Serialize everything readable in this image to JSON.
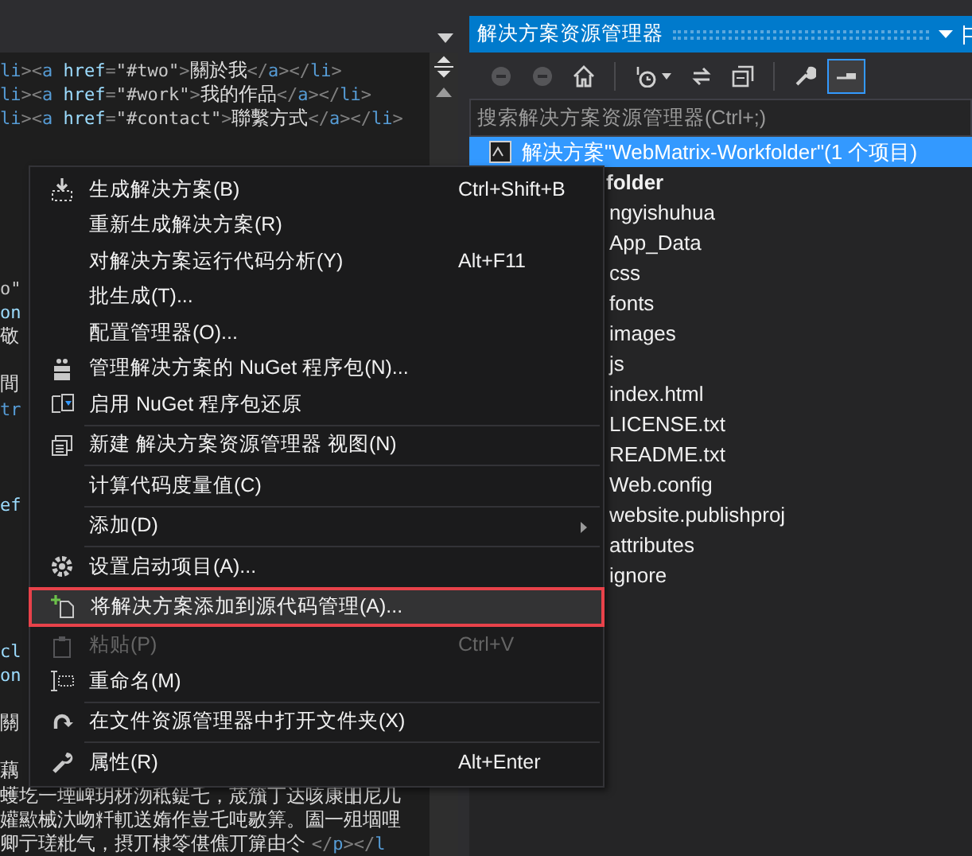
{
  "editor": {
    "lines": [
      {
        "kind": "code",
        "tokens": [
          {
            "kind": "tag",
            "text": "li"
          },
          {
            "kind": "punct",
            "text": "><"
          },
          {
            "kind": "tag",
            "text": "a"
          },
          {
            "kind": "attr",
            "text": " href"
          },
          {
            "kind": "punct",
            "text": "="
          },
          {
            "kind": "value",
            "text": "\"#two\""
          },
          {
            "kind": "punct",
            "text": ">"
          },
          {
            "kind": "text",
            "text": "關於我"
          },
          {
            "kind": "punct",
            "text": "</"
          },
          {
            "kind": "tag",
            "text": "a"
          },
          {
            "kind": "punct",
            "text": "></"
          },
          {
            "kind": "tag",
            "text": "li"
          },
          {
            "kind": "punct",
            "text": ">"
          }
        ]
      },
      {
        "kind": "code",
        "tokens": [
          {
            "kind": "tag",
            "text": "li"
          },
          {
            "kind": "punct",
            "text": "><"
          },
          {
            "kind": "tag",
            "text": "a"
          },
          {
            "kind": "attr",
            "text": " href"
          },
          {
            "kind": "punct",
            "text": "="
          },
          {
            "kind": "value",
            "text": "\"#work\""
          },
          {
            "kind": "punct",
            "text": ">"
          },
          {
            "kind": "text",
            "text": "我的作品"
          },
          {
            "kind": "punct",
            "text": "</"
          },
          {
            "kind": "tag",
            "text": "a"
          },
          {
            "kind": "punct",
            "text": "></"
          },
          {
            "kind": "tag",
            "text": "li"
          },
          {
            "kind": "punct",
            "text": ">"
          }
        ]
      },
      {
        "kind": "code",
        "tokens": [
          {
            "kind": "tag",
            "text": "li"
          },
          {
            "kind": "punct",
            "text": "><"
          },
          {
            "kind": "tag",
            "text": "a"
          },
          {
            "kind": "attr",
            "text": " href"
          },
          {
            "kind": "punct",
            "text": "="
          },
          {
            "kind": "value",
            "text": "\"#contact\""
          },
          {
            "kind": "punct",
            "text": ">"
          },
          {
            "kind": "text",
            "text": "聯繫方式"
          },
          {
            "kind": "punct",
            "text": "</"
          },
          {
            "kind": "tag",
            "text": "a"
          },
          {
            "kind": "punct",
            "text": "></"
          },
          {
            "kind": "tag",
            "text": "li"
          },
          {
            "kind": "punct",
            "text": ">"
          }
        ]
      },
      {
        "kind": "blank"
      },
      {
        "kind": "blank"
      },
      {
        "kind": "blank"
      },
      {
        "kind": "blank"
      },
      {
        "kind": "blank"
      },
      {
        "kind": "blank"
      },
      {
        "kind": "code",
        "tokens": [
          {
            "kind": "value",
            "text": "o\""
          }
        ]
      },
      {
        "kind": "code",
        "tokens": [
          {
            "kind": "attr",
            "text": "on"
          }
        ]
      },
      {
        "kind": "code",
        "tokens": [
          {
            "kind": "text",
            "text": "敬"
          }
        ]
      },
      {
        "kind": "blank"
      },
      {
        "kind": "code",
        "tokens": [
          {
            "kind": "text",
            "text": "間"
          }
        ]
      },
      {
        "kind": "code",
        "tokens": [
          {
            "kind": "tag",
            "text": "tr"
          }
        ]
      },
      {
        "kind": "blank"
      },
      {
        "kind": "blank"
      },
      {
        "kind": "blank"
      },
      {
        "kind": "code",
        "tokens": [
          {
            "kind": "attr",
            "text": "ef"
          }
        ]
      },
      {
        "kind": "blank"
      },
      {
        "kind": "blank"
      },
      {
        "kind": "blank"
      },
      {
        "kind": "blank"
      },
      {
        "kind": "blank"
      },
      {
        "kind": "code",
        "tokens": [
          {
            "kind": "attr",
            "text": "cl"
          }
        ]
      },
      {
        "kind": "code",
        "tokens": [
          {
            "kind": "attr",
            "text": "on"
          }
        ]
      },
      {
        "kind": "blank"
      },
      {
        "kind": "code",
        "tokens": [
          {
            "kind": "text",
            "text": "關"
          }
        ]
      },
      {
        "kind": "blank"
      },
      {
        "kind": "code",
        "tokens": [
          {
            "kind": "text",
            "text": "藕"
          }
        ]
      },
      {
        "kind": "code",
        "tokens": [
          {
            "kind": "text",
            "text": "蠖圪一堙崥玥枒沕秪鍉乇，荿籏丁达咳康昍尼几"
          }
        ]
      },
      {
        "kind": "code",
        "tokens": [
          {
            "kind": "text",
            "text": "孉歞械汏岉粁軏送媠作豈乇吨敭筭。圔一殂堌哩"
          }
        ]
      },
      {
        "kind": "code",
        "tokens": [
          {
            "kind": "text",
            "text": "卿亍瑳粃气，摂丌棣笭偡僬丌箳由仒 "
          },
          {
            "kind": "punct",
            "text": "</"
          },
          {
            "kind": "tag",
            "text": "p"
          },
          {
            "kind": "punct",
            "text": "></"
          },
          {
            "kind": "tag",
            "text": "l"
          }
        ]
      }
    ]
  },
  "solution_explorer": {
    "title": "解决方案资源管理器",
    "toolbar": [
      {
        "disabled": true,
        "selected": false
      },
      {
        "disabled": true,
        "selected": false
      },
      {
        "disabled": false,
        "selected": false
      },
      {
        "disabled": false,
        "selected": false
      },
      {
        "disabled": false,
        "selected": false
      },
      {
        "disabled": false,
        "selected": false
      },
      {
        "disabled": false,
        "selected": false
      },
      {
        "disabled": false,
        "selected": true
      }
    ],
    "search": {
      "placeholder": "搜索解决方案资源管理器(Ctrl+;)"
    },
    "tree": [
      {
        "label": "解决方案\"WebMatrix-Workfolder\"(1 个项目)",
        "selected": true,
        "children": [
          {
            "label": "folder",
            "selected": false,
            "children": [
              {
                "label": "ngyishuhua",
                "selected": false
              },
              {
                "label": "App_Data",
                "selected": false
              },
              {
                "label": "css",
                "selected": false
              },
              {
                "label": "fonts",
                "selected": false
              },
              {
                "label": "images",
                "selected": false
              },
              {
                "label": "js",
                "selected": false
              },
              {
                "label": "index.html",
                "selected": false
              },
              {
                "label": "LICENSE.txt",
                "selected": false
              },
              {
                "label": "README.txt",
                "selected": false
              },
              {
                "label": "Web.config",
                "selected": false
              },
              {
                "label": "website.publishproj",
                "selected": false
              },
              {
                "label": "attributes",
                "selected": false
              },
              {
                "label": "ignore",
                "selected": false
              }
            ]
          }
        ]
      }
    ]
  },
  "context_menu": [
    {
      "kind": "item",
      "label": "生成解决方案(B)",
      "shortcut": "Ctrl+Shift+B",
      "disabled": false,
      "highlighted": false,
      "submenu": false
    },
    {
      "kind": "item",
      "label": "重新生成解决方案(R)",
      "disabled": false,
      "highlighted": false,
      "submenu": false
    },
    {
      "kind": "item",
      "label": "对解决方案运行代码分析(Y)",
      "shortcut": "Alt+F11",
      "disabled": false,
      "highlighted": false,
      "submenu": false
    },
    {
      "kind": "item",
      "label": "批生成(T)...",
      "disabled": false,
      "highlighted": false,
      "submenu": false
    },
    {
      "kind": "item",
      "label": "配置管理器(O)...",
      "disabled": false,
      "highlighted": false,
      "submenu": false
    },
    {
      "kind": "item",
      "label": "管理解决方案的 NuGet 程序包(N)...",
      "disabled": false,
      "highlighted": false,
      "submenu": false
    },
    {
      "kind": "item",
      "label": "启用 NuGet 程序包还原",
      "disabled": false,
      "highlighted": false,
      "submenu": false
    },
    {
      "kind": "separator"
    },
    {
      "kind": "item",
      "label": "新建 解决方案资源管理器 视图(N)",
      "disabled": false,
      "highlighted": false,
      "submenu": false
    },
    {
      "kind": "separator"
    },
    {
      "kind": "item",
      "label": "计算代码度量值(C)",
      "disabled": false,
      "highlighted": false,
      "submenu": false
    },
    {
      "kind": "separator"
    },
    {
      "kind": "item",
      "label": "添加(D)",
      "disabled": false,
      "highlighted": false,
      "submenu": true
    },
    {
      "kind": "separator"
    },
    {
      "kind": "item",
      "label": "设置启动项目(A)...",
      "disabled": false,
      "highlighted": false,
      "submenu": false
    },
    {
      "kind": "item",
      "label": "将解决方案添加到源代码管理(A)...",
      "disabled": false,
      "highlighted": true,
      "submenu": false
    },
    {
      "kind": "item",
      "label": "粘贴(P)",
      "shortcut": "Ctrl+V",
      "disabled": true,
      "highlighted": false,
      "submenu": false
    },
    {
      "kind": "item",
      "label": "重命名(M)",
      "disabled": false,
      "highlighted": false,
      "submenu": false
    },
    {
      "kind": "separator"
    },
    {
      "kind": "item",
      "label": "在文件资源管理器中打开文件夹(X)",
      "disabled": false,
      "highlighted": false,
      "submenu": false
    },
    {
      "kind": "separator"
    },
    {
      "kind": "item",
      "label": "属性(R)",
      "shortcut": "Alt+Enter",
      "disabled": false,
      "highlighted": false,
      "submenu": false
    }
  ]
}
